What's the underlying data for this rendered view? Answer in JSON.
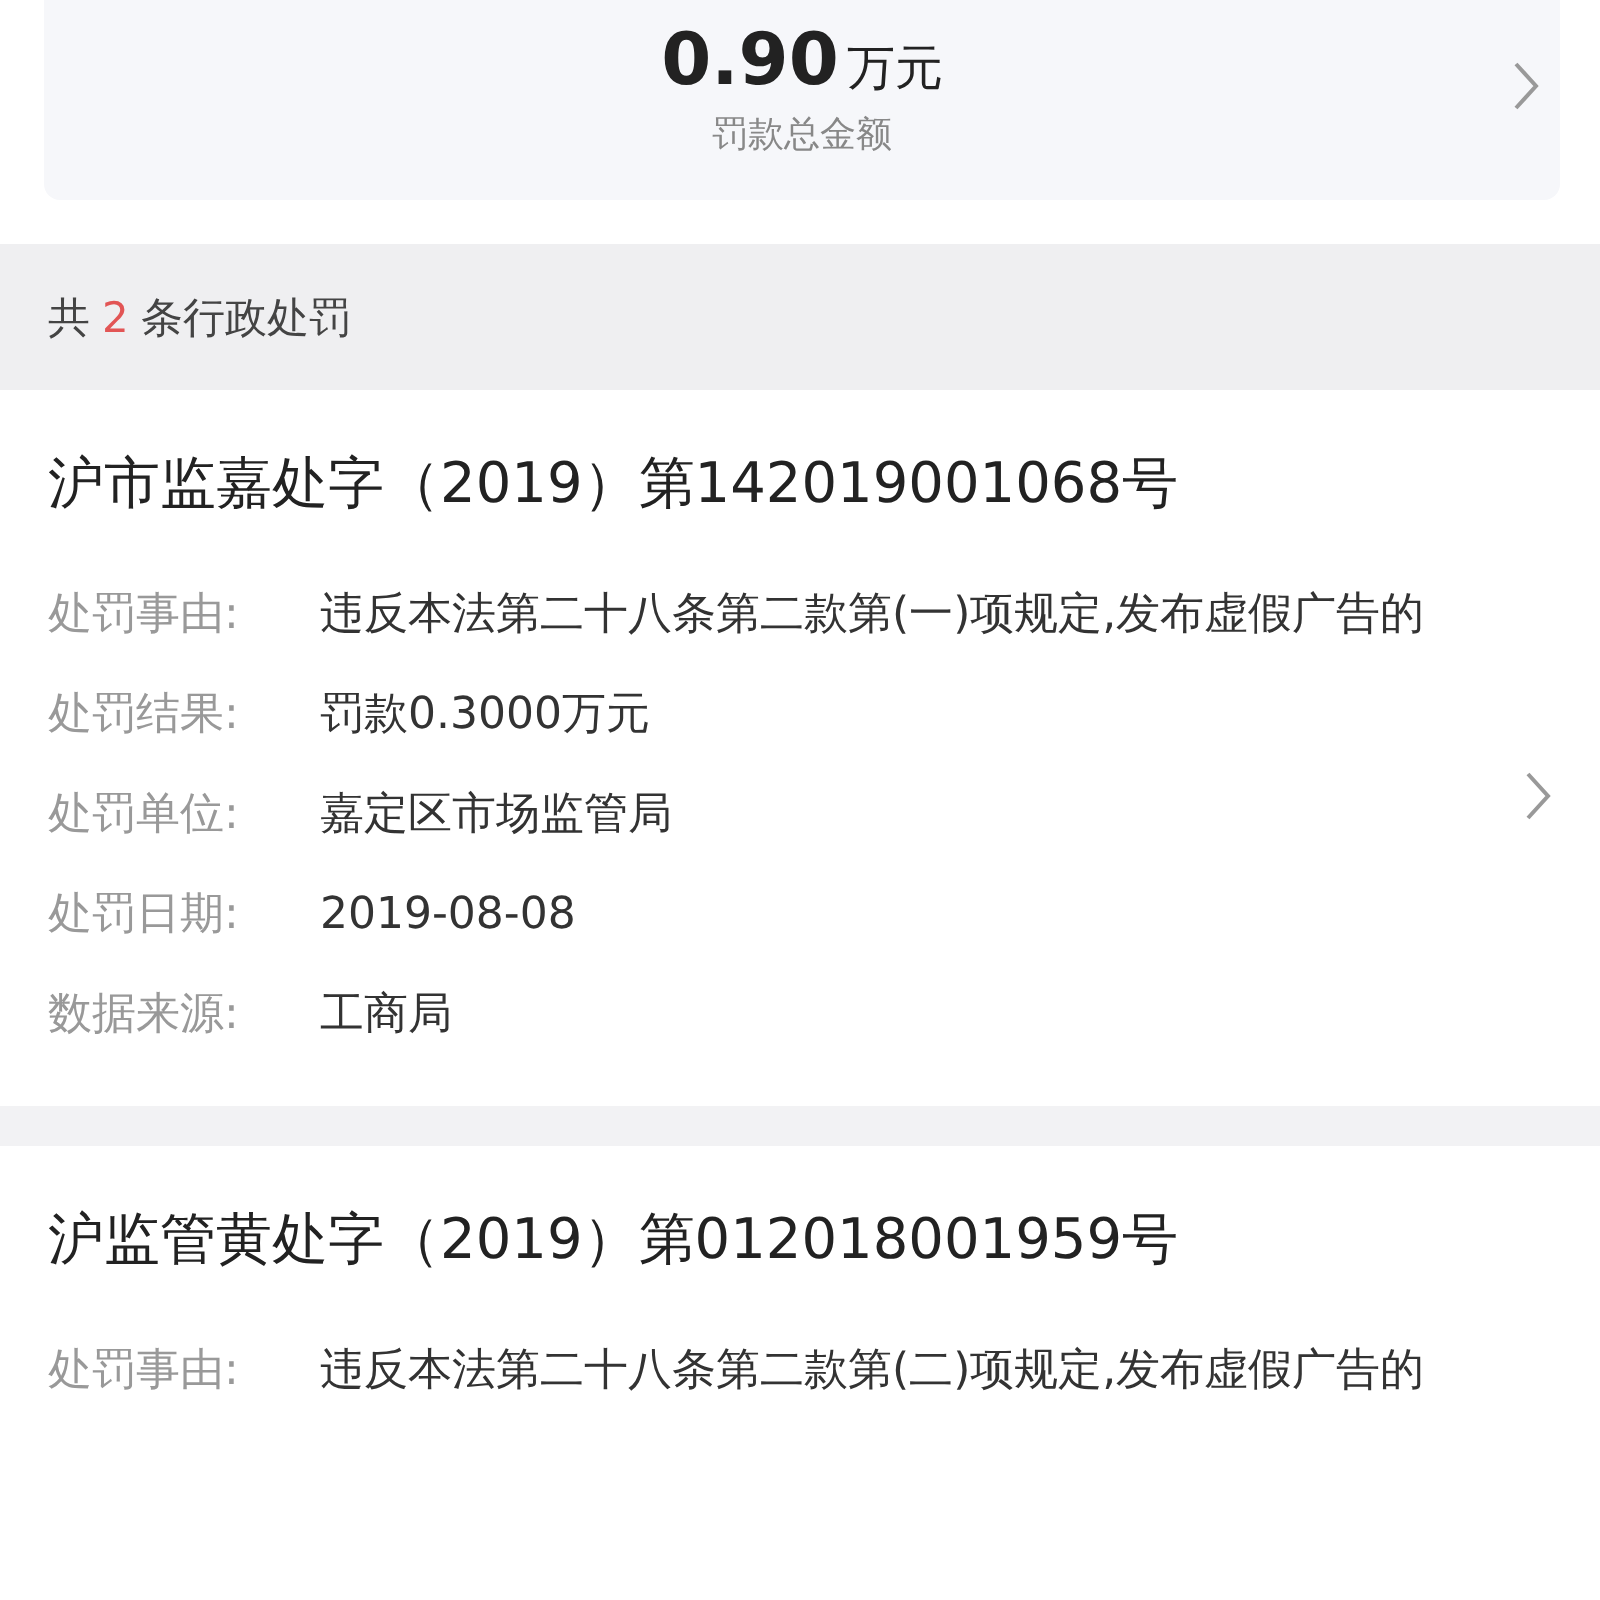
{
  "summary": {
    "amount": "0.90",
    "unit": "万元",
    "label": "罚款总金额"
  },
  "count_bar": {
    "prefix": "共",
    "count": "2",
    "suffix": "条行政处罚"
  },
  "records": [
    {
      "title": "沪市监嘉处字（2019）第142019001068号",
      "chevron": true,
      "fields": [
        {
          "label": "处罚事由:",
          "value": "违反本法第二十八条第二款第(一)项规定,发布虚假广告的"
        },
        {
          "label": "处罚结果:",
          "value": "罚款0.3000万元"
        },
        {
          "label": "处罚单位:",
          "value": "嘉定区市场监管局"
        },
        {
          "label": "处罚日期:",
          "value": "2019-08-08"
        },
        {
          "label": "数据来源:",
          "value": "工商局"
        }
      ]
    },
    {
      "title": "沪监管黄处字（2019）第012018001959号",
      "chevron": false,
      "fields": [
        {
          "label": "处罚事由:",
          "value": "违反本法第二十八条第二款第(二)项规定,发布虚假广告的"
        }
      ]
    }
  ]
}
